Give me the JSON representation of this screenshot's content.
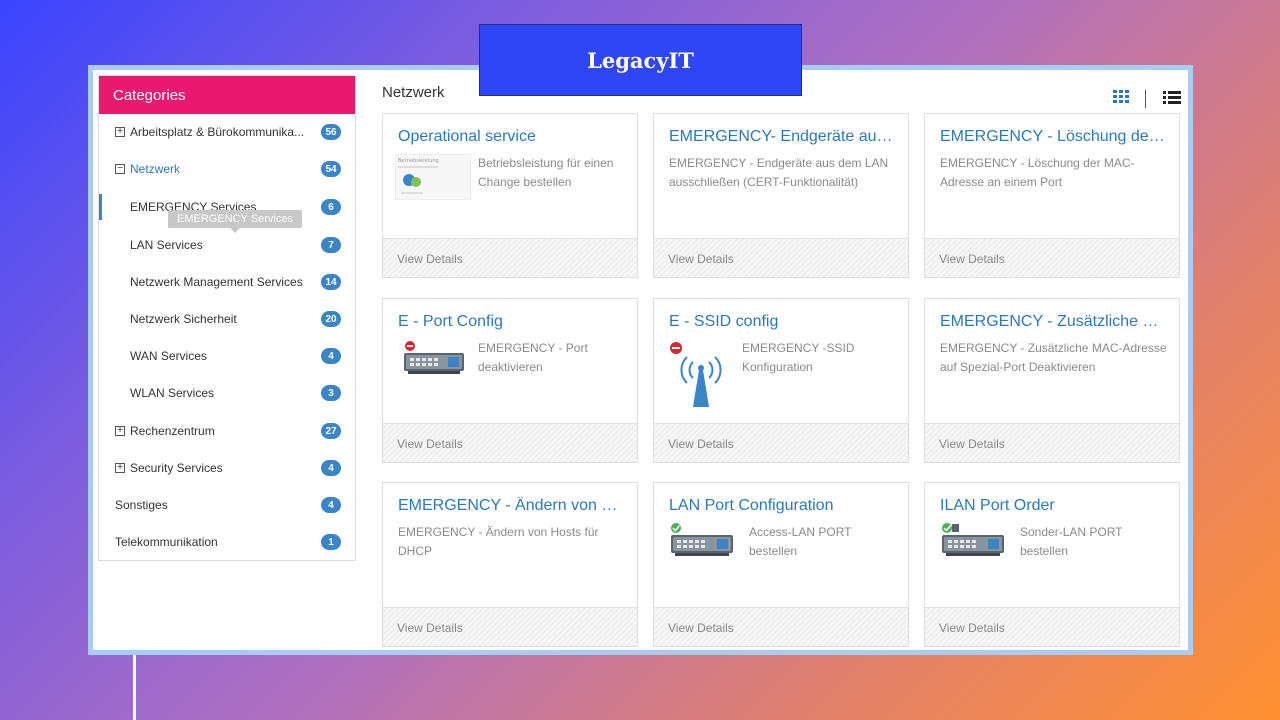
{
  "brand": "LegacyIT",
  "sidebar": {
    "header": "Categories",
    "tooltip": "EMERGENCY Services",
    "items": [
      {
        "label": "Arbeitsplatz & Bürokommunika...",
        "count": "56",
        "expander": "+"
      },
      {
        "label": "Netzwerk",
        "count": "54",
        "expander": "−"
      },
      {
        "label": "EMERGENCY Services",
        "count": "6"
      },
      {
        "label": "LAN Services",
        "count": "7"
      },
      {
        "label": "Netzwerk Management Services",
        "count": "14"
      },
      {
        "label": "Netzwerk Sicherheit",
        "count": "20"
      },
      {
        "label": "WAN Services",
        "count": "4"
      },
      {
        "label": "WLAN Services",
        "count": "3"
      },
      {
        "label": "Rechenzentrum",
        "count": "27",
        "expander": "+"
      },
      {
        "label": "Security Services",
        "count": "4",
        "expander": "+"
      },
      {
        "label": "Sonstiges",
        "count": "4"
      },
      {
        "label": "Telekommunikation",
        "count": "1"
      }
    ]
  },
  "main": {
    "title": "Netzwerk",
    "footer_label": "View Details",
    "cards": [
      {
        "title": "Operational service",
        "desc1": "Betriebsleistung für einen",
        "desc2": "Change bestellen",
        "icon": "document-thumbnail-icon",
        "thumb_text": "Betriebsleistung"
      },
      {
        "title": "EMERGENCY- Endgeräte aus ...",
        "desc1": "EMERGENCY - Endgeräte aus dem LAN",
        "desc2": "ausschließen (CERT-Funktionalität)"
      },
      {
        "title": "EMERGENCY - Löschung der ...",
        "desc1": "EMERGENCY - Löschung der MAC-",
        "desc2": "Adresse an einem Port"
      },
      {
        "title": "E - Port Config",
        "desc1": "EMERGENCY - Port",
        "desc2": "deaktivieren",
        "icon": "network-switch-blocked-icon"
      },
      {
        "title": "E - SSID config",
        "desc1": "EMERGENCY -SSID",
        "desc2": "Konfiguration",
        "icon": "wifi-antenna-blocked-icon"
      },
      {
        "title": "EMERGENCY - Zusätzliche MA...",
        "desc1": "EMERGENCY - Zusätzliche MAC-Adresse",
        "desc2": "auf Spezial-Port Deaktivieren"
      },
      {
        "title": "EMERGENCY - Ändern von Ho...",
        "desc1": "EMERGENCY - Ändern von Hosts für",
        "desc2": "DHCP"
      },
      {
        "title": "LAN Port Configuration",
        "desc1": "Access-LAN PORT",
        "desc2": "bestellen",
        "icon": "network-switch-check-icon"
      },
      {
        "title": "ILAN Port Order",
        "desc1": "Sonder-LAN PORT",
        "desc2": "bestellen",
        "icon": "network-switch-check-icon"
      }
    ]
  }
}
